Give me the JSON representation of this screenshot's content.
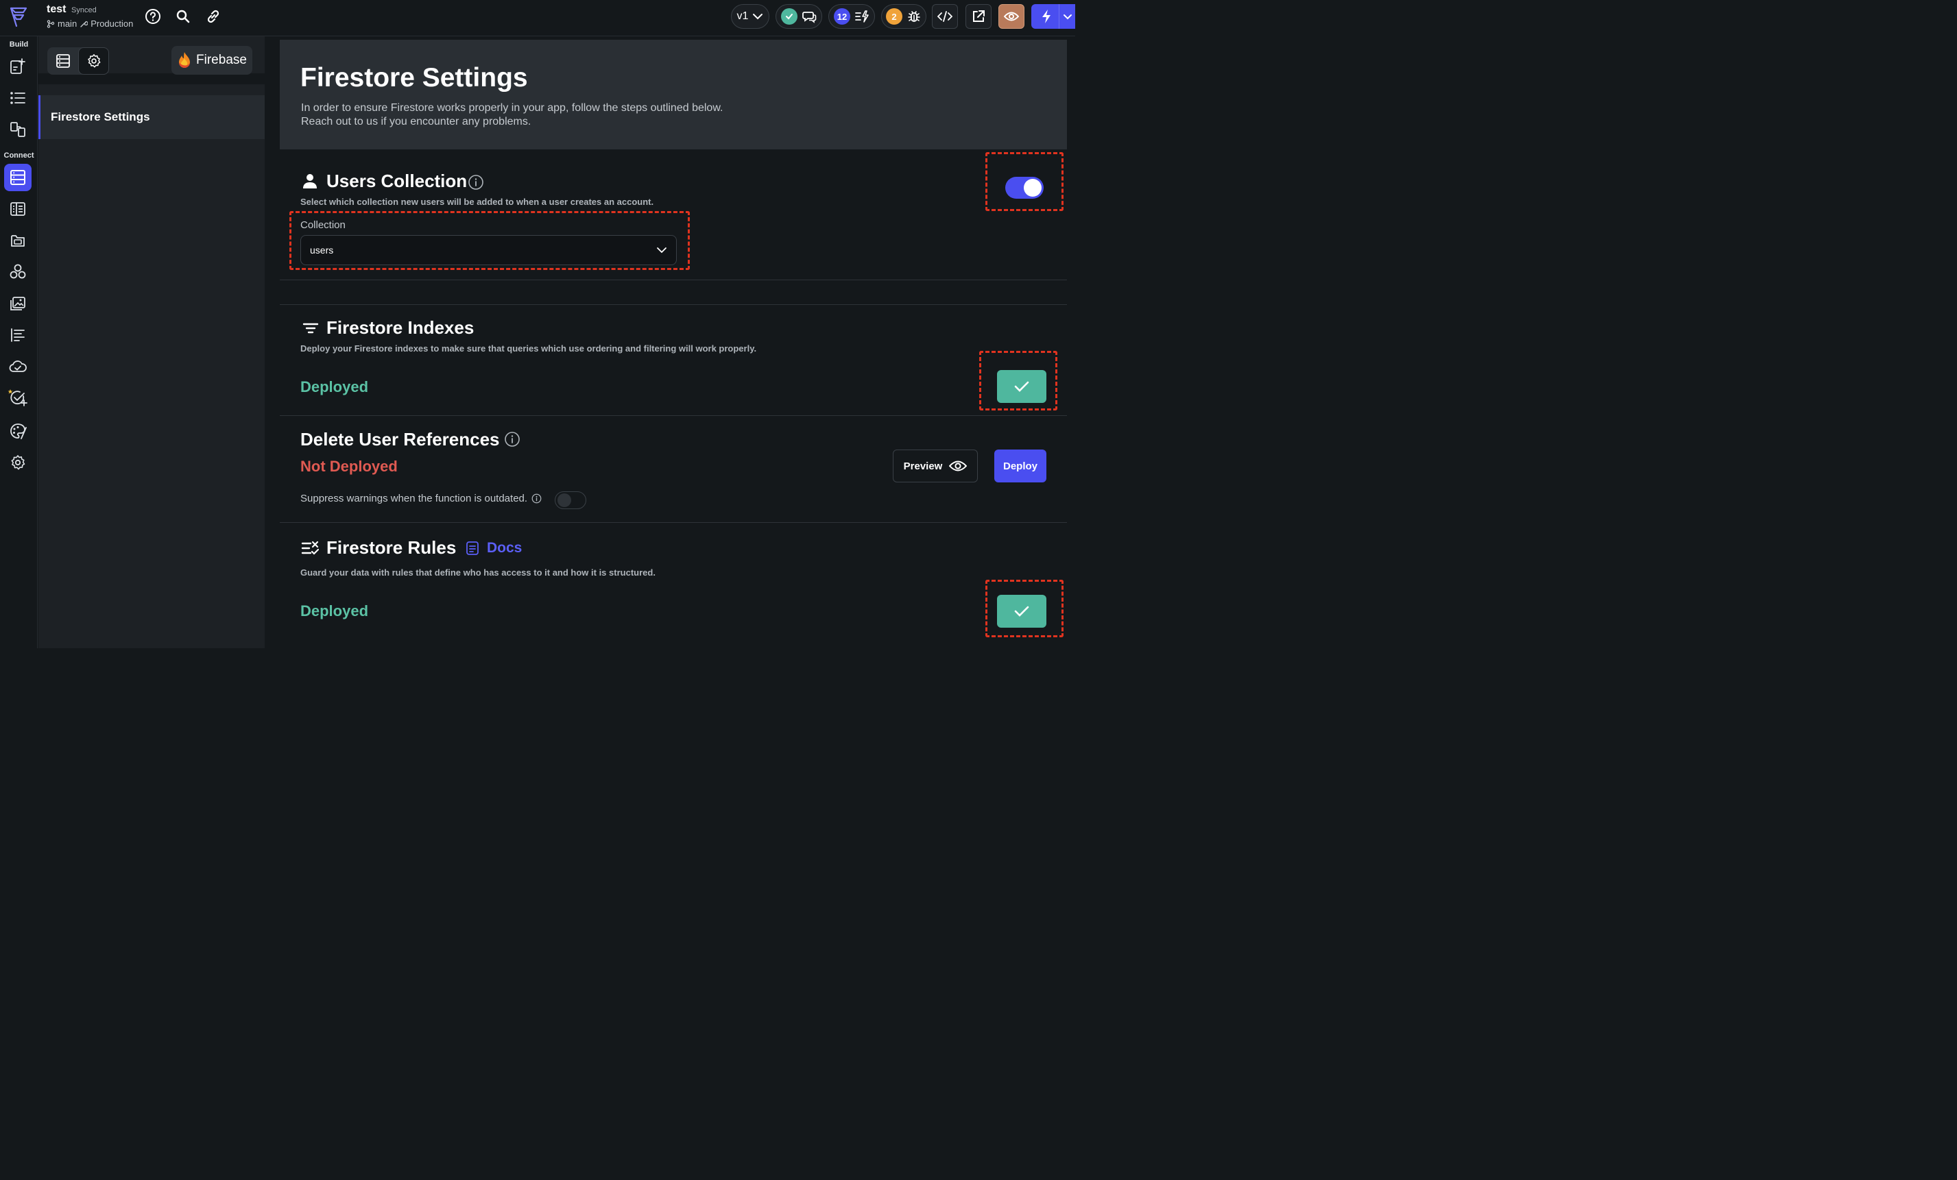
{
  "project": {
    "name": "test",
    "sync_status": "Synced",
    "branch": "main",
    "environment": "Production"
  },
  "topbar": {
    "version": "v1",
    "notification_count": "12",
    "issue_count": "2",
    "colors": {
      "accent": "#4a4ef0",
      "success": "#4fb79e",
      "warning": "#f0a33a"
    }
  },
  "leftnav": {
    "build_label": "Build",
    "connect_label": "Connect"
  },
  "panel": {
    "firebase_label": "Firebase",
    "active_item": "Firestore Settings"
  },
  "header": {
    "title": "Firestore Settings",
    "subtitle_line1": "In order to ensure Firestore works properly in your app, follow the steps outlined below.",
    "subtitle_line2": "Reach out to us if you encounter any problems."
  },
  "users_collection": {
    "title": "Users Collection",
    "description": "Select which collection new users will be added to when a user creates an account.",
    "field_label": "Collection",
    "selected_value": "users",
    "enabled": true
  },
  "firestore_indexes": {
    "title": "Firestore Indexes",
    "description": "Deploy your Firestore indexes to make sure that queries which use ordering and filtering will work properly.",
    "status": "Deployed"
  },
  "delete_user_refs": {
    "title": "Delete User References",
    "status": "Not Deployed",
    "suppress_label": "Suppress warnings when the function is outdated.",
    "preview_label": "Preview",
    "deploy_label": "Deploy"
  },
  "firestore_rules": {
    "title": "Firestore Rules",
    "docs_label": "Docs",
    "description": "Guard your data with rules that define who has access to it and how it is structured.",
    "status": "Deployed"
  }
}
